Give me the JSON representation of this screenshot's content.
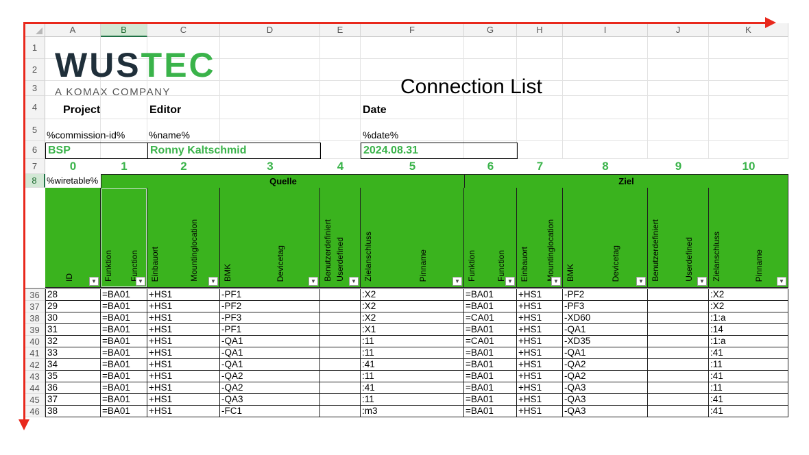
{
  "columns": [
    "A",
    "B",
    "C",
    "D",
    "E",
    "F",
    "G",
    "H",
    "I",
    "J",
    "K"
  ],
  "selected_column": "B",
  "top_rows": [
    "1",
    "2",
    "3",
    "4",
    "5",
    "6",
    "7",
    "8"
  ],
  "logo": {
    "wus": "WUS",
    "tec": "TEC",
    "tagline": "A KOMAX COMPANY"
  },
  "title": "Connection List",
  "labels": {
    "project": "Project",
    "editor": "Editor",
    "date": "Date"
  },
  "placeholders": {
    "commission": "%commission-id%",
    "name": "%name%",
    "date": "%date%"
  },
  "values": {
    "project": "BSP",
    "editor": "Ronny Kaltschmid",
    "date": "2024.08.31"
  },
  "indices": [
    "0",
    "1",
    "2",
    "3",
    "4",
    "5",
    "6",
    "7",
    "8",
    "9",
    "10"
  ],
  "wiretable_tag": "%wiretable%",
  "groups": {
    "source": "Quelle",
    "target": "Ziel"
  },
  "headers": [
    {
      "de": "",
      "en": "ID"
    },
    {
      "de": "Funktion",
      "en": "Function"
    },
    {
      "de": "Einbauort",
      "en": "Mountinglocation"
    },
    {
      "de": "BMK",
      "en": "Devicetag"
    },
    {
      "de": "Benutzerdefiniert",
      "en": "Userdefined"
    },
    {
      "de": "Zielanschluss",
      "en": "Pinname"
    },
    {
      "de": "Funktion",
      "en": "Function"
    },
    {
      "de": "Einbauort",
      "en": "Mountinglocation"
    },
    {
      "de": "BMK",
      "en": "Devicetag"
    },
    {
      "de": "Benutzerdefiniert",
      "en": "Userdefined"
    },
    {
      "de": "Zielanschluss",
      "en": "Pinname"
    }
  ],
  "rows": [
    {
      "n": "36",
      "cells": [
        "28",
        "=BA01",
        "+HS1",
        "-PF1",
        "",
        ":X2",
        "=BA01",
        "+HS1",
        "-PF2",
        "",
        ":X2"
      ]
    },
    {
      "n": "37",
      "cells": [
        "29",
        "=BA01",
        "+HS1",
        "-PF2",
        "",
        ":X2",
        "=BA01",
        "+HS1",
        "-PF3",
        "",
        ":X2"
      ]
    },
    {
      "n": "38",
      "cells": [
        "30",
        "=BA01",
        "+HS1",
        "-PF3",
        "",
        ":X2",
        "=CA01",
        "+HS1",
        "-XD60",
        "",
        ":1:a"
      ]
    },
    {
      "n": "39",
      "cells": [
        "31",
        "=BA01",
        "+HS1",
        "-PF1",
        "",
        ":X1",
        "=BA01",
        "+HS1",
        "-QA1",
        "",
        ":14"
      ]
    },
    {
      "n": "40",
      "cells": [
        "32",
        "=BA01",
        "+HS1",
        "-QA1",
        "",
        ":11",
        "=CA01",
        "+HS1",
        "-XD35",
        "",
        ":1:a"
      ]
    },
    {
      "n": "41",
      "cells": [
        "33",
        "=BA01",
        "+HS1",
        "-QA1",
        "",
        ":11",
        "=BA01",
        "+HS1",
        "-QA1",
        "",
        ":41"
      ]
    },
    {
      "n": "42",
      "cells": [
        "34",
        "=BA01",
        "+HS1",
        "-QA1",
        "",
        ":41",
        "=BA01",
        "+HS1",
        "-QA2",
        "",
        ":11"
      ]
    },
    {
      "n": "43",
      "cells": [
        "35",
        "=BA01",
        "+HS1",
        "-QA2",
        "",
        ":11",
        "=BA01",
        "+HS1",
        "-QA2",
        "",
        ":41"
      ]
    },
    {
      "n": "44",
      "cells": [
        "36",
        "=BA01",
        "+HS1",
        "-QA2",
        "",
        ":41",
        "=BA01",
        "+HS1",
        "-QA3",
        "",
        ":11"
      ]
    },
    {
      "n": "45",
      "cells": [
        "37",
        "=BA01",
        "+HS1",
        "-QA3",
        "",
        ":11",
        "=BA01",
        "+HS1",
        "-QA3",
        "",
        ":41"
      ]
    },
    {
      "n": "46",
      "cells": [
        "38",
        "=BA01",
        "+HS1",
        "-FC1",
        "",
        ":m3",
        "=BA01",
        "+HS1",
        "-QA3",
        "",
        ":41"
      ]
    }
  ],
  "colors": {
    "green_fill": "#3ab31e",
    "green_text": "#3ab34a",
    "arrow": "#e8281c"
  }
}
